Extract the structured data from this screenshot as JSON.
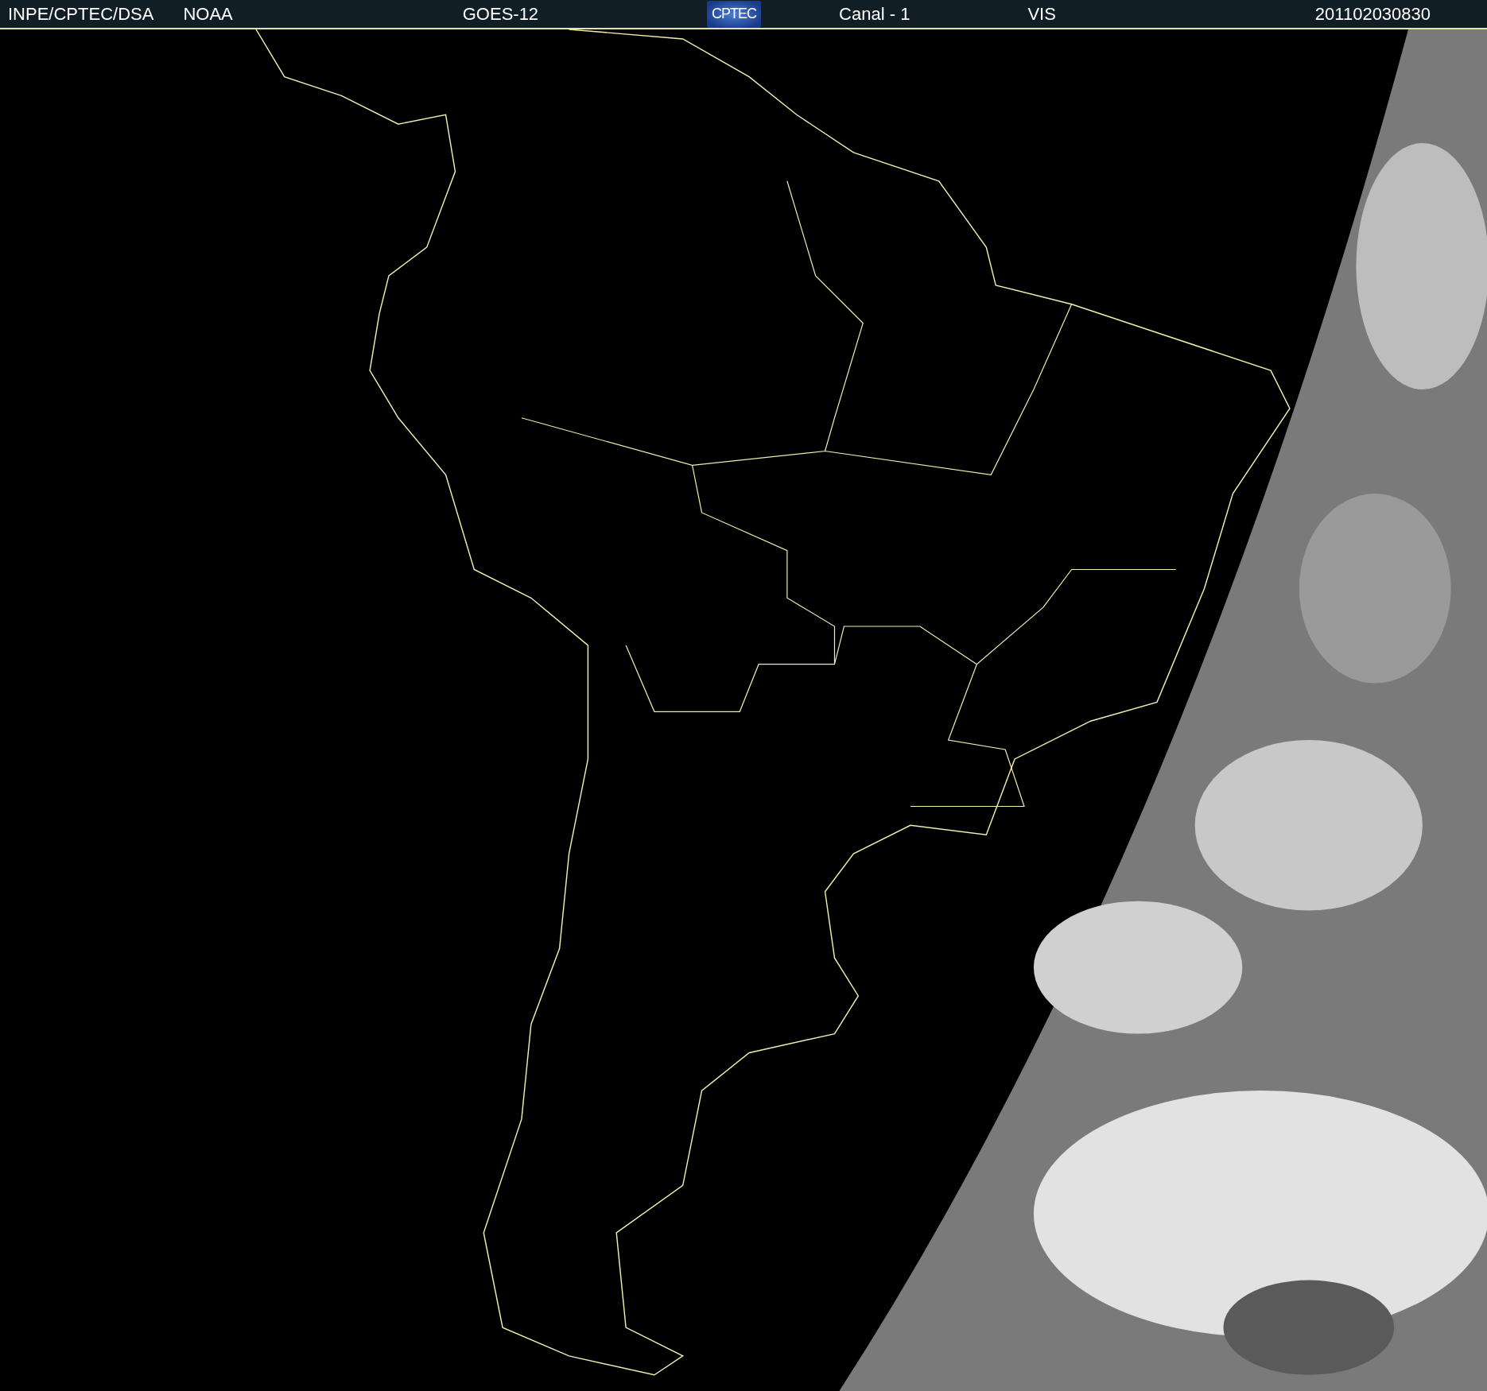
{
  "header": {
    "items": [
      {
        "text": "INPE/CPTEC/DSA"
      },
      {
        "text": "NOAA"
      },
      {
        "text": "GOES-12"
      },
      {
        "text": "Canal - 1"
      },
      {
        "text": "VIS"
      },
      {
        "text": "201102030830"
      }
    ],
    "logo": {
      "text": "CPTEC"
    }
  }
}
